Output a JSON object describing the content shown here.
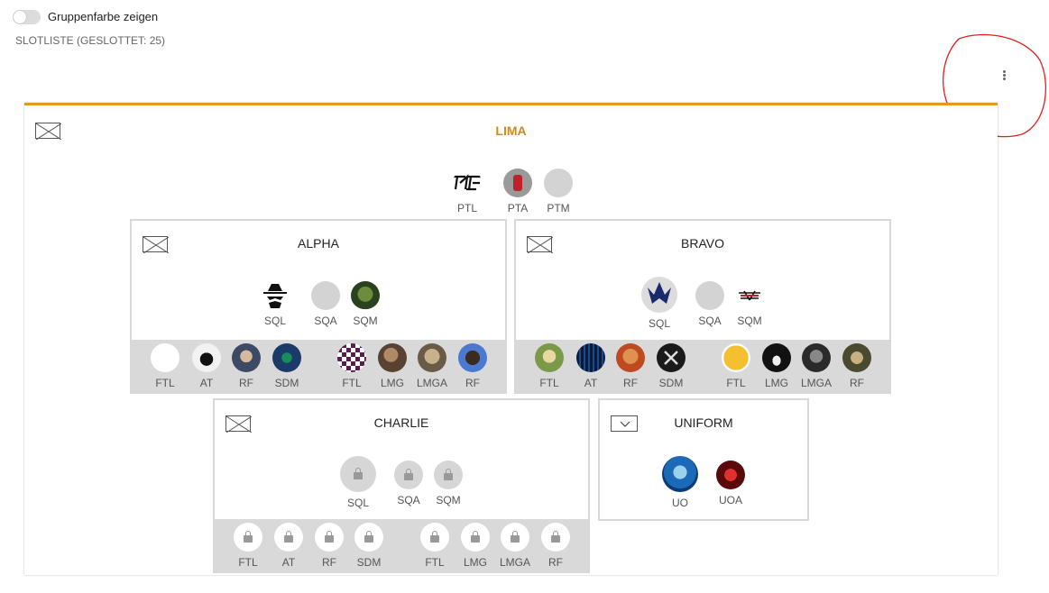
{
  "toggle": {
    "label": "Gruppenfarbe zeigen",
    "state": "off"
  },
  "slot_count": "SLOTLISTE (GESLOTTET: 25)",
  "colors": {
    "accent": "#e8961e",
    "title": "#d08a1c",
    "fireteam_bg": "#d9d9d9",
    "annotation": "#e02020"
  },
  "platoon": {
    "name": "LIMA",
    "slots": [
      {
        "label": "PTL",
        "icon": "eve-logo-icon"
      },
      {
        "label": "PTA",
        "icon": "fire-extinguisher-avatar-icon"
      },
      {
        "label": "PTM",
        "icon": "empty-slot-icon"
      }
    ]
  },
  "squads": [
    {
      "name": "ALPHA",
      "leaders": [
        {
          "label": "SQL",
          "icon": "spy-avatar-icon"
        },
        {
          "label": "SQA",
          "icon": "empty-slot-icon"
        },
        {
          "label": "SQM",
          "icon": "hooded-figure-avatar-icon"
        }
      ],
      "fireteams": [
        {
          "label": "FTL"
        },
        {
          "label": "AT"
        },
        {
          "label": "RF"
        },
        {
          "label": "SDM"
        },
        {
          "label": "FTL"
        },
        {
          "label": "LMG"
        },
        {
          "label": "LMGA"
        },
        {
          "label": "RF"
        }
      ]
    },
    {
      "name": "BRAVO",
      "leaders": [
        {
          "label": "SQL",
          "icon": "blue-emblem-avatar-icon"
        },
        {
          "label": "SQA",
          "icon": "empty-slot-icon"
        },
        {
          "label": "SQM",
          "icon": "red-logo-avatar-icon"
        }
      ],
      "fireteams": [
        {
          "label": "FTL"
        },
        {
          "label": "AT"
        },
        {
          "label": "RF"
        },
        {
          "label": "SDM"
        },
        {
          "label": "FTL"
        },
        {
          "label": "LMG"
        },
        {
          "label": "LMGA"
        },
        {
          "label": "RF"
        }
      ]
    },
    {
      "name": "CHARLIE",
      "leaders": [
        {
          "label": "SQL",
          "icon": "lock-icon"
        },
        {
          "label": "SQA",
          "icon": "lock-icon"
        },
        {
          "label": "SQM",
          "icon": "lock-icon"
        }
      ],
      "fireteams": [
        {
          "label": "FTL"
        },
        {
          "label": "AT"
        },
        {
          "label": "RF"
        },
        {
          "label": "SDM"
        },
        {
          "label": "FTL"
        },
        {
          "label": "LMG"
        },
        {
          "label": "LMGA"
        },
        {
          "label": "RF"
        }
      ]
    },
    {
      "name": "UNIFORM",
      "leaders": [
        {
          "label": "UO",
          "icon": "blue-skull-avatar-icon"
        },
        {
          "label": "UOA",
          "icon": "red-demon-avatar-icon"
        }
      ]
    }
  ]
}
